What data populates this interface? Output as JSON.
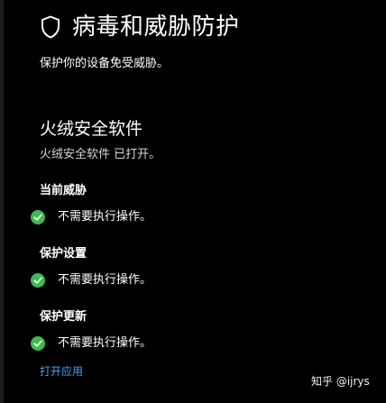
{
  "header": {
    "title": "病毒和威胁防护",
    "icon": "shield-icon",
    "subtitle": "保护你的设备免受威胁。"
  },
  "provider": {
    "name": "火绒安全软件",
    "status": "火绒安全软件 已打开。"
  },
  "sections": [
    {
      "heading": "当前威胁",
      "status": "不需要执行操作。",
      "icon": "check-circle-icon"
    },
    {
      "heading": "保护设置",
      "status": "不需要执行操作。",
      "icon": "check-circle-icon"
    },
    {
      "heading": "保护更新",
      "status": "不需要执行操作。",
      "icon": "check-circle-icon"
    }
  ],
  "open_app_link": "打开应用",
  "watermark": "知乎 @ijrys",
  "colors": {
    "background": "#000000",
    "text": "#ffffff",
    "ok_green": "#3fb950",
    "link": "#4aa3f0"
  }
}
